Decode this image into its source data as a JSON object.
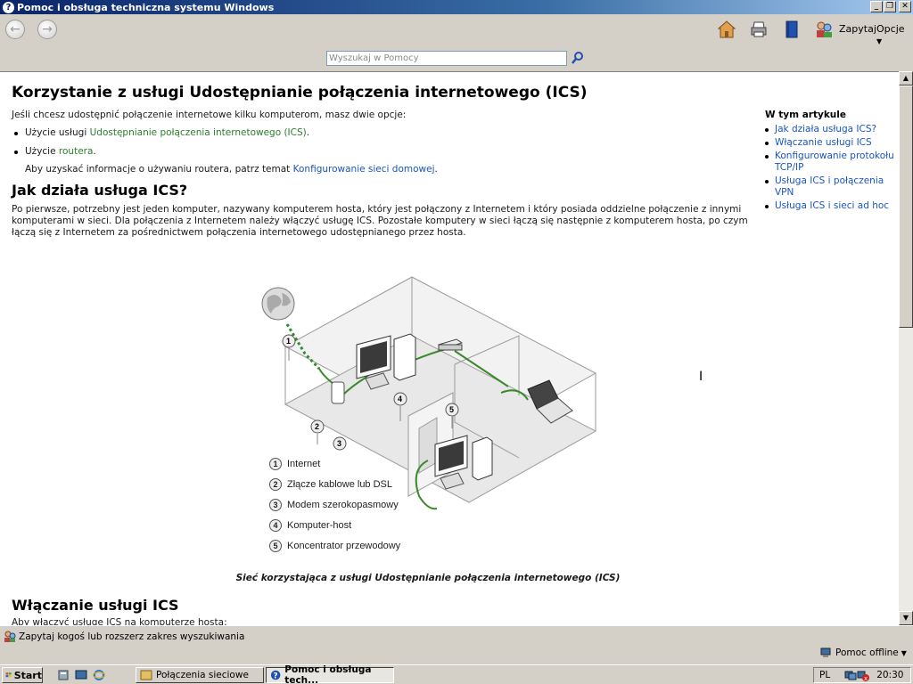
{
  "window": {
    "title": "Pomoc i obsługa techniczna systemu Windows"
  },
  "toolbar": {
    "back_icon": "back-arrow-icon",
    "forward_icon": "forward-arrow-icon",
    "ask_label": "Zapytaj",
    "options_label": "Opcje"
  },
  "search": {
    "placeholder": "Wyszukaj w Pomocy"
  },
  "article": {
    "title": "Korzystanie z usługi Udostępnianie połączenia internetowego (ICS)",
    "intro": "Jeśli chcesz udostępnić połączenie internetowe kilku komputerom, masz dwie opcje:",
    "option1_prefix": "Użycie usługi ",
    "option1_link": "Udostępnianie połączenia internetowego (ICS)",
    "option1_suffix": ".",
    "option2_prefix": "Użycie ",
    "option2_link": "routera",
    "option2_suffix": ".",
    "router_info_prefix": "Aby uzyskać informacje o używaniu routera, patrz temat ",
    "router_info_link": "Konfigurowanie sieci domowej",
    "router_info_suffix": ".",
    "section1_title": "Jak działa usługa ICS?",
    "section1_line1": "Po pierwsze, potrzebny jest jeden komputer, nazywany komputerem hosta, który jest połączony z Internetem i który posiada oddzielne połączenie z innymi",
    "section1_line2": "komputerami w sieci. Dla połączenia z Internetem należy włączyć usługę ICS. Pozostałe komputery w sieci łączą się następnie z komputerem hosta, po czym",
    "section1_line3": "łączą się z Internetem za pośrednictwem połączenia internetowego udostępnianego przez hosta.",
    "figure_caption": "Sieć korzystająca z usługi Udostępnianie połączenia internetowego (ICS)",
    "section2_title": "Włączanie usługi ICS",
    "section2_intro": "Aby włączyć usługę ICS na komputerze hosta:"
  },
  "diagram": {
    "callouts": [
      "1",
      "2",
      "3",
      "4",
      "5"
    ],
    "legend": [
      {
        "num": "1",
        "label": "Internet"
      },
      {
        "num": "2",
        "label": "Złącze kablowe lub DSL"
      },
      {
        "num": "3",
        "label": "Modem szerokopasmowy"
      },
      {
        "num": "4",
        "label": "Komputer-host"
      },
      {
        "num": "5",
        "label": "Koncentrator przewodowy"
      }
    ]
  },
  "sidebar": {
    "heading": "W tym artykule",
    "links": [
      "Jak działa usługa ICS?",
      "Włączanie usługi ICS",
      "Konfigurowanie protokołu TCP/IP",
      "Usługa ICS i połączenia VPN",
      "Usługa ICS i sieci ad hoc"
    ]
  },
  "bottom": {
    "ask_text": "Zapytaj kogoś lub rozszerz zakres wyszukiwania",
    "offline_label": "Pomoc offline"
  },
  "taskbar": {
    "start_label": "Start",
    "tasks": [
      "Połączenia sieciowe",
      "Pomoc i obsługa tech..."
    ],
    "language": "PL",
    "clock": "20:30"
  },
  "colors": {
    "link": "#1a55c0",
    "green_link": "#2d7d2d",
    "title_bar": "#0a246a"
  }
}
